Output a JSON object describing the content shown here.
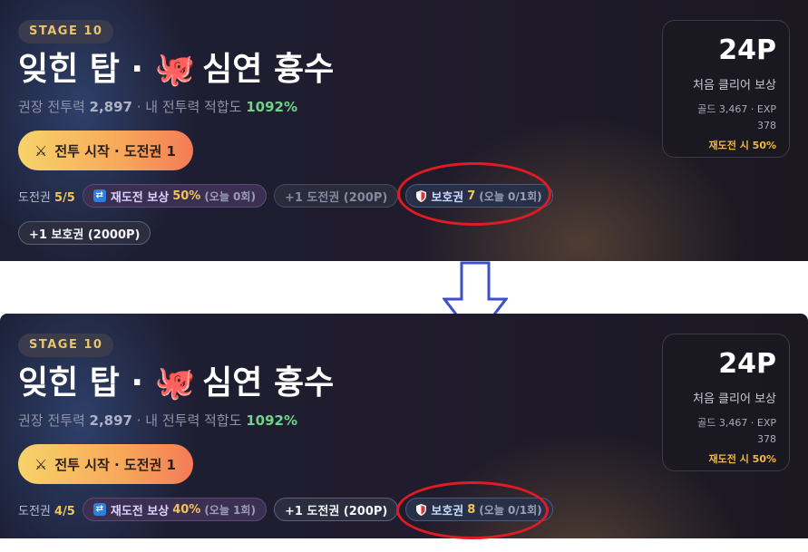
{
  "before": {
    "stage_badge": "STAGE 10",
    "title_part1": "잊힌 탑 · ",
    "title_icon": "🐙",
    "title_part2": " 심연 흉수",
    "power_label": "권장 전투력 ",
    "power_value": "2,897",
    "my_power_label": " · 내 전투력 적합도 ",
    "fit_value": "1092%",
    "start_button": "전투 시작 · 도전권 1",
    "ticket_label": "도전권 ",
    "ticket_count": "5/5",
    "retry_label": "재도전 보상",
    "retry_pct": "50%",
    "retry_today": "(오늘 0회)",
    "buy_ticket": "+1 도전권 (200P)",
    "shield_label": "보호권",
    "shield_count": "7",
    "shield_today": "(오늘 0/1회)",
    "buy_shield": "+1 보호권 (2000P)",
    "reward_points": "24P",
    "reward_first": "처음 클리어 보상",
    "reward_gold_line1": "골드 3,467 · EXP",
    "reward_gold_line2": "378",
    "reward_retry": "재도전 시 50%"
  },
  "after": {
    "stage_badge": "STAGE 10",
    "title_part1": "잊힌 탑 · ",
    "title_icon": "🐙",
    "title_part2": " 심연 흉수",
    "power_label": "권장 전투력 ",
    "power_value": "2,897",
    "my_power_label": " · 내 전투력 적합도 ",
    "fit_value": "1092%",
    "start_button": "전투 시작 · 도전권 1",
    "ticket_label": "도전권 ",
    "ticket_count": "4/5",
    "retry_label": "재도전 보상",
    "retry_pct": "40%",
    "retry_today": "(오늘 1회)",
    "buy_ticket": "+1 도전권 (200P)",
    "shield_label": "보호권",
    "shield_count": "8",
    "shield_today": "(오늘 0/1회)",
    "reward_points": "24P",
    "reward_first": "처음 클리어 보상",
    "reward_gold_line1": "골드 3,467 · EXP",
    "reward_gold_line2": "378",
    "reward_retry": "재도전 시 50%"
  },
  "colors": {
    "accent_gold": "#f3c35a",
    "fit_green": "#6fd38a",
    "highlight_red": "#e21b23",
    "arrow_blue": "#3b4fc8"
  }
}
